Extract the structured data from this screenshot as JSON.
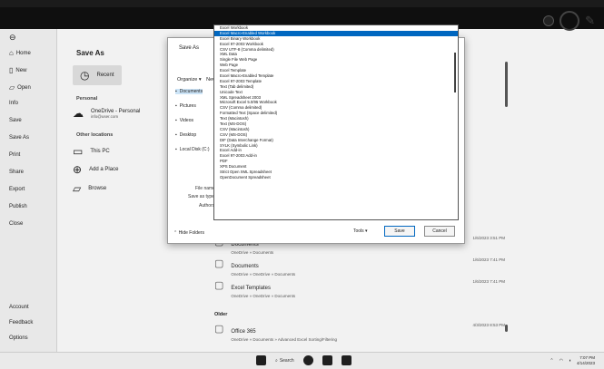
{
  "backstage": {
    "nav": [
      {
        "label": "Home",
        "icon": "home-icon"
      },
      {
        "label": "New",
        "icon": "new-file-icon"
      },
      {
        "label": "Open",
        "icon": "folder-open-icon"
      },
      {
        "label": "Info",
        "icon": ""
      },
      {
        "label": "Save",
        "icon": ""
      },
      {
        "label": "Save As",
        "icon": ""
      },
      {
        "label": "Print",
        "icon": ""
      },
      {
        "label": "Share",
        "icon": ""
      },
      {
        "label": "Export",
        "icon": ""
      },
      {
        "label": "Publish",
        "icon": ""
      },
      {
        "label": "Close",
        "icon": ""
      }
    ],
    "nav_bottom": [
      {
        "label": "Account"
      },
      {
        "label": "Feedback"
      },
      {
        "label": "Options"
      }
    ],
    "title": "Save As",
    "recent_label": "Recent",
    "personal_label": "Personal",
    "onedrive_title": "OneDrive - Personal",
    "onedrive_sub": "info@user.com",
    "other_locations_label": "Other locations",
    "this_pc": "This PC",
    "add_place": "Add a Place",
    "browse": "Browse"
  },
  "files": [
    {
      "name": "Documents",
      "path": "OneDrive » Documents",
      "date": "1/6/2023 3:51 PM"
    },
    {
      "name": "Documents",
      "path": "OneDrive » OneDrive » Documents",
      "date": "1/6/2023 7:41 PM"
    },
    {
      "name": "Excel Templates",
      "path": "OneDrive » OneDrive » Documents",
      "date": "1/6/2023 7:41 PM"
    }
  ],
  "other_label": "Older",
  "older_files": [
    {
      "name": "Office 365",
      "path": "OneDrive » Documents » Advanced Excel Sorting/Filtering",
      "date": "4/3/2023 8:53 PM"
    }
  ],
  "dialog": {
    "title": "Save As",
    "organize": "Organize ▾",
    "new_folder": "New folder",
    "tree": [
      {
        "label": "Documents",
        "selected": true
      },
      {
        "label": "Pictures",
        "selected": false
      },
      {
        "label": "Videos",
        "selected": false
      },
      {
        "label": "Desktop",
        "selected": false
      },
      {
        "label": "Local Disk (C:)",
        "selected": false
      }
    ],
    "file_name_label": "File name:",
    "save_as_type_label": "Save as type:",
    "authors_label": "Authors:",
    "hide_folders": "Hide Folders",
    "tools": "Tools ▾",
    "save_button": "Save",
    "cancel_button": "Cancel"
  },
  "type_options": [
    {
      "label": "Excel Workbook",
      "selected": false
    },
    {
      "label": "Excel Macro-Enabled Workbook",
      "selected": true
    },
    {
      "label": "Excel Binary Workbook",
      "selected": false
    },
    {
      "label": "Excel 97-2003 Workbook",
      "selected": false
    },
    {
      "label": "CSV UTF-8 (Comma delimited)",
      "selected": false
    },
    {
      "label": "XML Data",
      "selected": false
    },
    {
      "label": "Single File Web Page",
      "selected": false
    },
    {
      "label": "Web Page",
      "selected": false
    },
    {
      "label": "Excel Template",
      "selected": false
    },
    {
      "label": "Excel Macro-Enabled Template",
      "selected": false
    },
    {
      "label": "Excel 97-2003 Template",
      "selected": false
    },
    {
      "label": "Text (Tab delimited)",
      "selected": false
    },
    {
      "label": "Unicode Text",
      "selected": false
    },
    {
      "label": "XML Spreadsheet 2003",
      "selected": false
    },
    {
      "label": "Microsoft Excel 5.0/95 Workbook",
      "selected": false
    },
    {
      "label": "CSV (Comma delimited)",
      "selected": false
    },
    {
      "label": "Formatted Text (Space delimited)",
      "selected": false
    },
    {
      "label": "Text (Macintosh)",
      "selected": false
    },
    {
      "label": "Text (MS-DOS)",
      "selected": false
    },
    {
      "label": "CSV (Macintosh)",
      "selected": false
    },
    {
      "label": "CSV (MS-DOS)",
      "selected": false
    },
    {
      "label": "DIF (Data Interchange Format)",
      "selected": false
    },
    {
      "label": "SYLK (Symbolic Link)",
      "selected": false
    },
    {
      "label": "Excel Add-in",
      "selected": false
    },
    {
      "label": "Excel 97-2003 Add-in",
      "selected": false
    },
    {
      "label": "PDF",
      "selected": false
    },
    {
      "label": "XPS Document",
      "selected": false
    },
    {
      "label": "Strict Open XML Spreadsheet",
      "selected": false
    },
    {
      "label": "OpenDocument Spreadsheet",
      "selected": false
    }
  ],
  "taskbar": {
    "search_label": "Search",
    "time": "7:07 PM",
    "date": "4/14/2023"
  }
}
